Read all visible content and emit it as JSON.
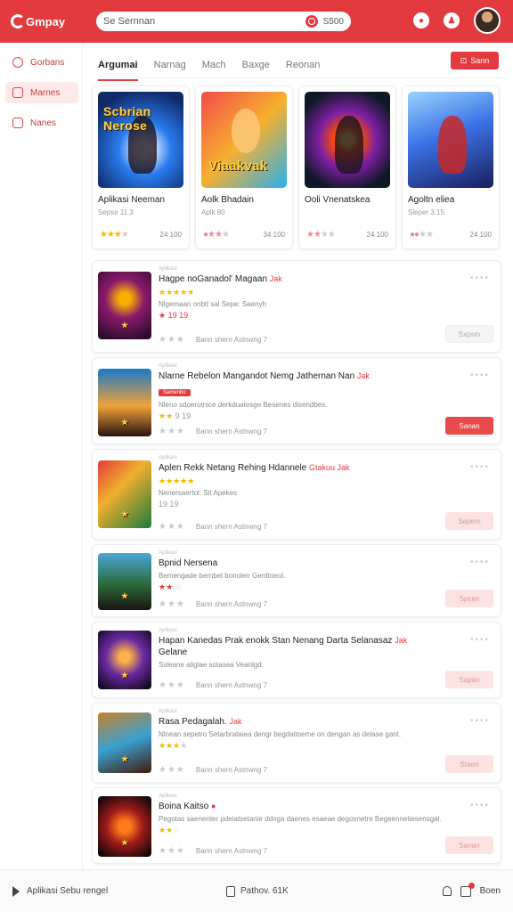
{
  "app": {
    "logo": "Gmpay"
  },
  "search": {
    "query": "Se Sernnan",
    "button": "S500"
  },
  "sidebar": {
    "items": [
      {
        "label": "Gorbans",
        "icon": "search-icon"
      },
      {
        "label": "Marnes",
        "icon": "calendar-icon",
        "active": true
      },
      {
        "label": "Nanes",
        "icon": "list-icon"
      }
    ]
  },
  "tabs": [
    "Argumai",
    "Narnag",
    "Mach",
    "Baxge",
    "Reonan"
  ],
  "tab_button": "Sann",
  "featured": [
    {
      "thumb_text": "Scbrian Nerose",
      "name": "Aplikasi Neeman",
      "sub": "Sepse 11.3",
      "rating": 3,
      "count": "24 100"
    },
    {
      "thumb_text": "Viaakvak",
      "name": "Aolk Bhadain",
      "sub": "Aplk 80",
      "rating": 2,
      "count": "34 100"
    },
    {
      "thumb_text": "",
      "name": "Ooli Vnenatskea",
      "sub": "",
      "rating": 2,
      "count": "24 100"
    },
    {
      "thumb_text": "",
      "name": "Agoltn eliea",
      "sub": "Sleper 3.15",
      "rating": 2,
      "count": "24 100"
    }
  ],
  "list": [
    {
      "meta": "Aplikasi",
      "title": "Hagpe noGanadol' Magaan",
      "hot": "Jak",
      "desc": "Nlgemaan onbtl sal Sepe: Saenyh",
      "badge": "",
      "stars_line": "★ 19 19",
      "btn": "Sxpsm",
      "btn_style": "ghost",
      "footer": "Bann shern Astnwng 7"
    },
    {
      "meta": "Aplikasi",
      "title": "Nlarne Rebelon Mangandot Nemg Jathernan Nan",
      "hot": "Jak",
      "desc": "Nleno sdoerotnice derkduatesge Besenes disendbes.",
      "badge": "Samenbo",
      "stars_line": "9 19",
      "btn": "Sanan",
      "btn_style": "red",
      "footer": "Bann shern Astnwng 7"
    },
    {
      "meta": "Aplikasi",
      "title": "Aplen Rekk Netang Rehing Hdannele",
      "hot": "Gtakuu Jak",
      "desc": "Nenersaertol: Sit Apekes",
      "badge": "",
      "stars_line": "19 19",
      "btn": "Sapem",
      "btn_style": "pink",
      "footer": "Bann shern Astnwng 7"
    },
    {
      "meta": "Aplikasi",
      "title": "Bpnid Nersena",
      "hot": "",
      "desc": "Bemengade bernbel bonolen Gerdtoeol.",
      "badge": "",
      "stars_line": "",
      "btn": "Spcen",
      "btn_style": "pink",
      "footer": "Bann shern Astnwng 7"
    },
    {
      "meta": "Aplikasi",
      "title": "Hapan Kanedas Prak enokk Stan Nenang Darta Selanasaz",
      "hot": "Jak",
      "desc": "Ssleane aliglae sotasea Veanlgd.",
      "badge": "",
      "stars_line": "★ 19",
      "btn": "Sapan",
      "btn_style": "pink",
      "footer": "Bann shern Astnwng 7",
      "title2": "Gelane"
    },
    {
      "meta": "Aplikasi",
      "title": "Rasa Pedagalah.",
      "hot": "Jak",
      "desc": "Nlnean sepetro Setarbrataiea dengr begdaitoeme on dengan as delase gant.",
      "badge": "",
      "stars_line": "",
      "btn": "Staen",
      "btn_style": "pink",
      "footer": "Bann shern Astnwng 7"
    },
    {
      "meta": "Aplikasi",
      "title": "Boina Kaitso",
      "hot": "",
      "desc": "Pegotas saenenter pdeiatsetanie ddnga daenes esaeae degosnetre Begeennetiesensgal.",
      "badge": "",
      "stars_line": "",
      "btn": "Sanan",
      "btn_style": "pink",
      "footer": "Bann shern Astnwng 7"
    }
  ],
  "bottom": {
    "left": "Aplikasi Sebu rengel",
    "mid": "Pathov. 61K",
    "right": "Boen"
  }
}
